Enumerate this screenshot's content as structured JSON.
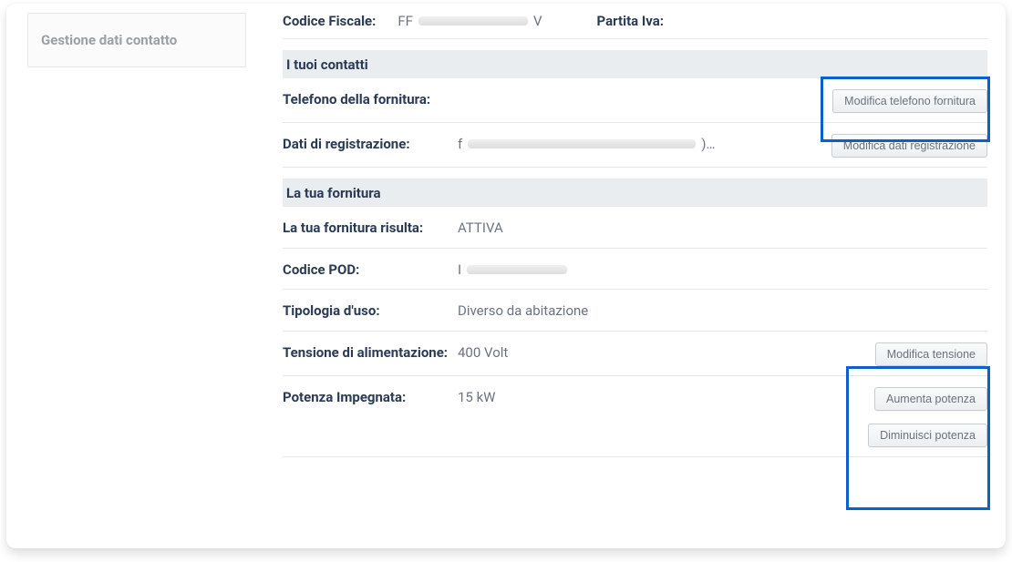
{
  "sidebar": {
    "tab_label": "Gestione dati contatto"
  },
  "top": {
    "codice_fiscale_label": "Codice Fiscale:",
    "codice_fiscale_prefix": "FF",
    "codice_fiscale_suffix": "V",
    "partita_iva_label": "Partita Iva:"
  },
  "sections": {
    "contatti": {
      "heading": "I tuoi contatti",
      "telefono_label": "Telefono della fornitura:",
      "telefono_btn": "Modifica telefono fornitura",
      "dati_label": "Dati di registrazione:",
      "dati_prefix": "f",
      "dati_suffix": ")…",
      "dati_btn": "Modifica dati registrazione"
    },
    "fornitura": {
      "heading": "La tua fornitura",
      "stato_label": "La tua fornitura risulta:",
      "stato_value": "ATTIVA",
      "pod_label": "Codice POD:",
      "pod_prefix": "I",
      "tipologia_label": "Tipologia d'uso:",
      "tipologia_value": "Diverso da abitazione",
      "tensione_label": "Tensione di alimentazione:",
      "tensione_value": "400 Volt",
      "tensione_btn": "Modifica tensione",
      "potenza_label": "Potenza Impegnata:",
      "potenza_value": "15 kW",
      "potenza_inc_btn": "Aumenta potenza",
      "potenza_dec_btn": "Diminuisci potenza"
    }
  }
}
